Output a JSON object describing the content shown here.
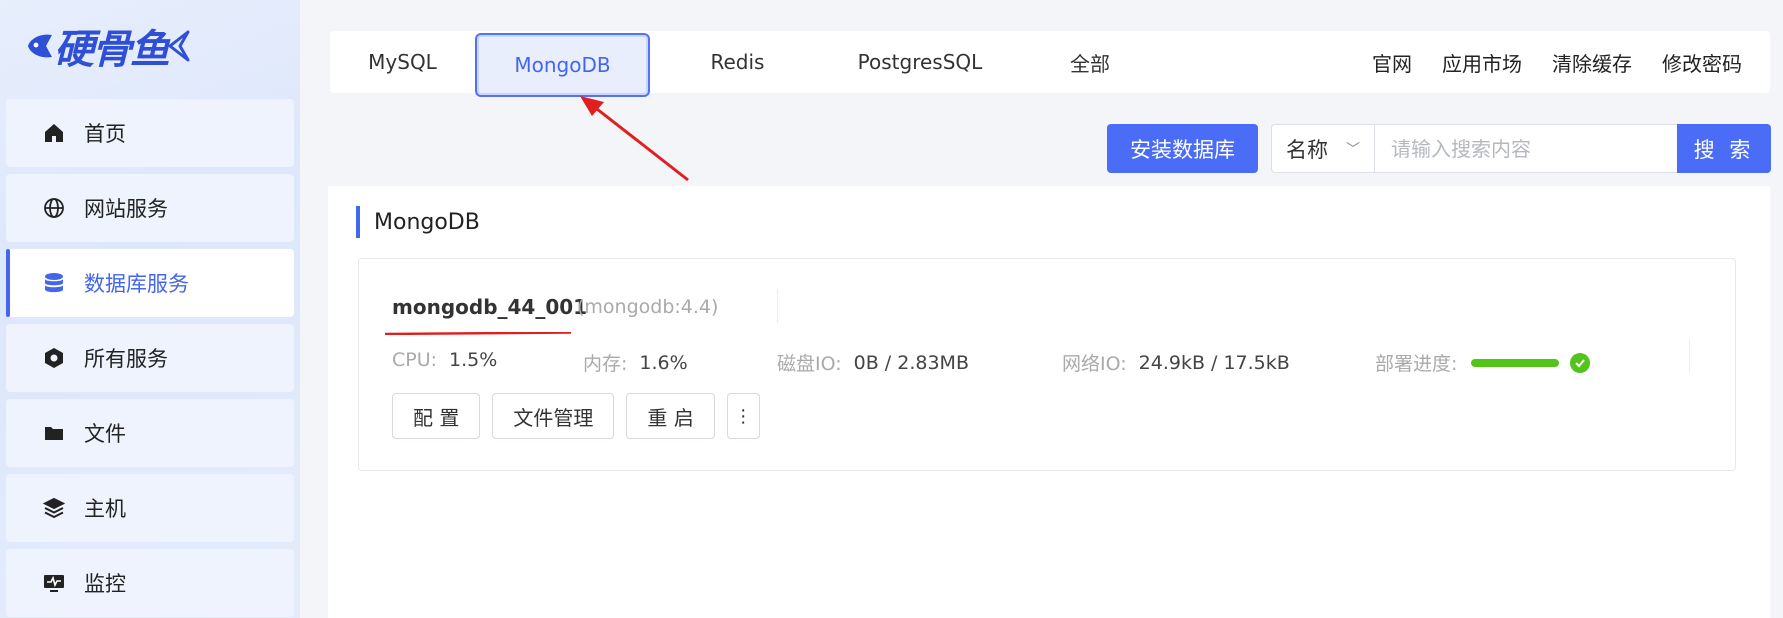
{
  "brand": {
    "logo_text": "硬骨鱼"
  },
  "sidebar": {
    "items": [
      {
        "label": "首页",
        "icon": "home-icon",
        "active": false
      },
      {
        "label": "网站服务",
        "icon": "globe-icon",
        "active": false
      },
      {
        "label": "数据库服务",
        "icon": "database-icon",
        "active": true
      },
      {
        "label": "所有服务",
        "icon": "services-icon",
        "active": false
      },
      {
        "label": "文件",
        "icon": "folder-icon",
        "active": false
      },
      {
        "label": "主机",
        "icon": "host-icon",
        "active": false
      },
      {
        "label": "监控",
        "icon": "monitor-icon",
        "active": false
      }
    ]
  },
  "tabs": [
    "MySQL",
    "MongoDB",
    "Redis",
    "PostgresSQL",
    "全部"
  ],
  "selected_tab": "MongoDB",
  "header_links": [
    "官网",
    "应用市场",
    "清除缓存",
    "修改密码"
  ],
  "toolbar": {
    "install_label": "安装数据库",
    "filter_selected": "名称",
    "search_placeholder": "请输入搜索内容",
    "search_label": "搜 索"
  },
  "section": {
    "title": "MongoDB"
  },
  "instance": {
    "name": "mongodb_44_001",
    "version": "(mongodb:4.4)",
    "stats": {
      "cpu_label": "CPU:",
      "cpu_value": "1.5%",
      "mem_label": "内存:",
      "mem_value": "1.6%",
      "disk_label": "磁盘IO:",
      "disk_value": "0B / 2.83MB",
      "net_label": "网络IO:",
      "net_value": "24.9kB / 17.5kB",
      "deploy_label": "部署进度:",
      "deploy_progress": 1.0
    },
    "actions": [
      "配 置",
      "文件管理",
      "重 启",
      "⋮"
    ]
  },
  "colors": {
    "accent": "#4a6cf7",
    "success": "#52c41a",
    "annotation": "#e02020"
  }
}
